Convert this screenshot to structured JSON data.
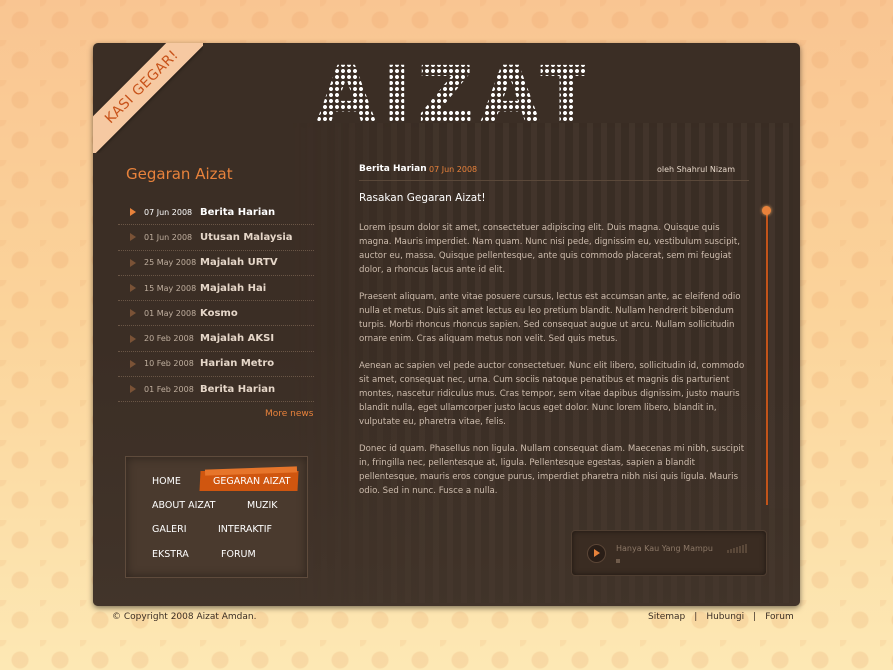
{
  "ribbon": "KASI GEGAR!",
  "logo": "AIZAT",
  "sidebar": {
    "title": "Gegaran Aizat",
    "news": [
      {
        "date": "07 Jun 2008",
        "source": "Berita Harian"
      },
      {
        "date": "01 Jun 2008",
        "source": "Utusan Malaysia"
      },
      {
        "date": "25 May 2008",
        "source": "Majalah URTV"
      },
      {
        "date": "15 May 2008",
        "source": "Majalah Hai"
      },
      {
        "date": "01 May 2008",
        "source": "Kosmo"
      },
      {
        "date": "20 Feb 2008",
        "source": "Majalah AKSI"
      },
      {
        "date": "10 Feb 2008",
        "source": "Harian Metro"
      },
      {
        "date": "01 Feb 2008",
        "source": "Berita Harian"
      }
    ],
    "more_news": "More news"
  },
  "nav": {
    "home": "HOME",
    "gegaran": "GEGARAN AIZAT",
    "about": "ABOUT AIZAT",
    "muzik": "MUZIK",
    "galeri": "GALERI",
    "interaktif": "INTERAKTIF",
    "ekstra": "EKSTRA",
    "forum": "FORUM"
  },
  "article": {
    "source": "Berita Harian",
    "date": "07 Jun 2008",
    "author": "oleh Shahrul Nizam",
    "title": "Rasakan Gegaran Aizat!",
    "paragraphs": [
      " Lorem ipsum dolor sit amet, consectetuer adipiscing elit. Duis magna. Quisque quis magna. Mauris imperdiet. Nam quam. Nunc nisi pede, dignissim eu, vestibulum suscipit, auctor eu, massa. Quisque pellentesque, ante quis commodo placerat, sem mi feugiat dolor, a rhoncus lacus ante id elit.",
      "Praesent aliquam, ante vitae posuere cursus, lectus est accumsan ante, ac eleifend odio nulla et metus. Duis sit amet lectus eu leo pretium blandit. Nullam hendrerit bibendum turpis. Morbi rhoncus rhoncus sapien. Sed consequat augue ut arcu. Nullam sollicitudin ornare enim. Cras aliquam metus non velit. Sed quis metus.",
      "Aenean ac sapien vel pede auctor consectetuer. Nunc elit libero, sollicitudin id, commodo sit amet, consequat nec, urna. Cum sociis natoque penatibus et magnis dis parturient montes, nascetur ridiculus mus. Cras tempor, sem vitae dapibus dignissim, justo mauris blandit nulla, eget ullamcorper justo lacus eget dolor. Nunc lorem libero, blandit in, vulputate eu, pharetra vitae, felis.",
      "Donec id quam. Phasellus non ligula. Nullam consequat diam. Maecenas mi nibh, suscipit in, fringilla nec, pellentesque at, ligula. Pellentesque egestas, sapien a blandit pellentesque, mauris eros congue purus, imperdiet pharetra nibh nisi quis ligula. Mauris odio. Sed in nunc. Fusce a nulla."
    ]
  },
  "player": {
    "track": "Hanya Kau Yang Mampu"
  },
  "footer": {
    "copyright": "© Copyright 2008 Aizat Amdan.",
    "links": [
      "Sitemap",
      "Hubungi",
      "Forum"
    ],
    "separator": "|"
  },
  "colors": {
    "accent": "#e8823b",
    "panel": "#3b2e25",
    "nav_active": "#d0560f"
  }
}
